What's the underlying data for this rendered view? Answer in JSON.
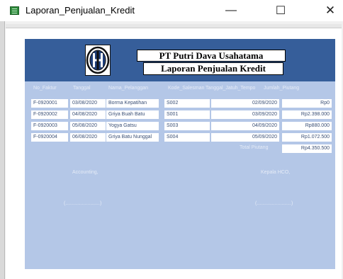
{
  "window": {
    "title": "Laporan_Penjualan_Kredit",
    "minimize": "—",
    "maximize": "☐",
    "close": "✕"
  },
  "report": {
    "company": "PT Putri Dava Usahatama",
    "title": "Laporan Penjualan Kredit",
    "columns": [
      "No_Faktur",
      "Tanggal",
      "Nama_Pelanggan",
      "Kode_Salesman",
      "Tanggal_Jatuh_Tempo",
      "Jumlah_Piutang"
    ],
    "rows": [
      [
        "F-0920001",
        "03/08/2020",
        "Borma Kepatihan",
        "S002",
        "02/09/2020",
        "Rp0"
      ],
      [
        "F-0920002",
        "04/08/2020",
        "Griya Buah Batu",
        "S001",
        "03/09/2020",
        "Rp2.398.000"
      ],
      [
        "F-0920003",
        "05/08/2020",
        "Yogya Gatsu",
        "S003",
        "04/09/2020",
        "Rp880.000"
      ],
      [
        "F-0920004",
        "06/08/2020",
        "Griya Batu Nunggal",
        "S004",
        "05/09/2020",
        "Rp1.072.500"
      ]
    ],
    "total_label": "Total Piutang",
    "total_value": "Rp4.350.500",
    "sign_left": "Accounting,",
    "sign_right": "Kepala HCO,",
    "sign_line_left": "(.........................)",
    "sign_line_right": "(.........................)"
  },
  "colors": {
    "header_band": "#365e9a",
    "report_body": "#b4c7e7",
    "app_icon": "#2e8b3c"
  },
  "icons": {
    "app": "access-report-icon",
    "logo": "company-logo"
  }
}
